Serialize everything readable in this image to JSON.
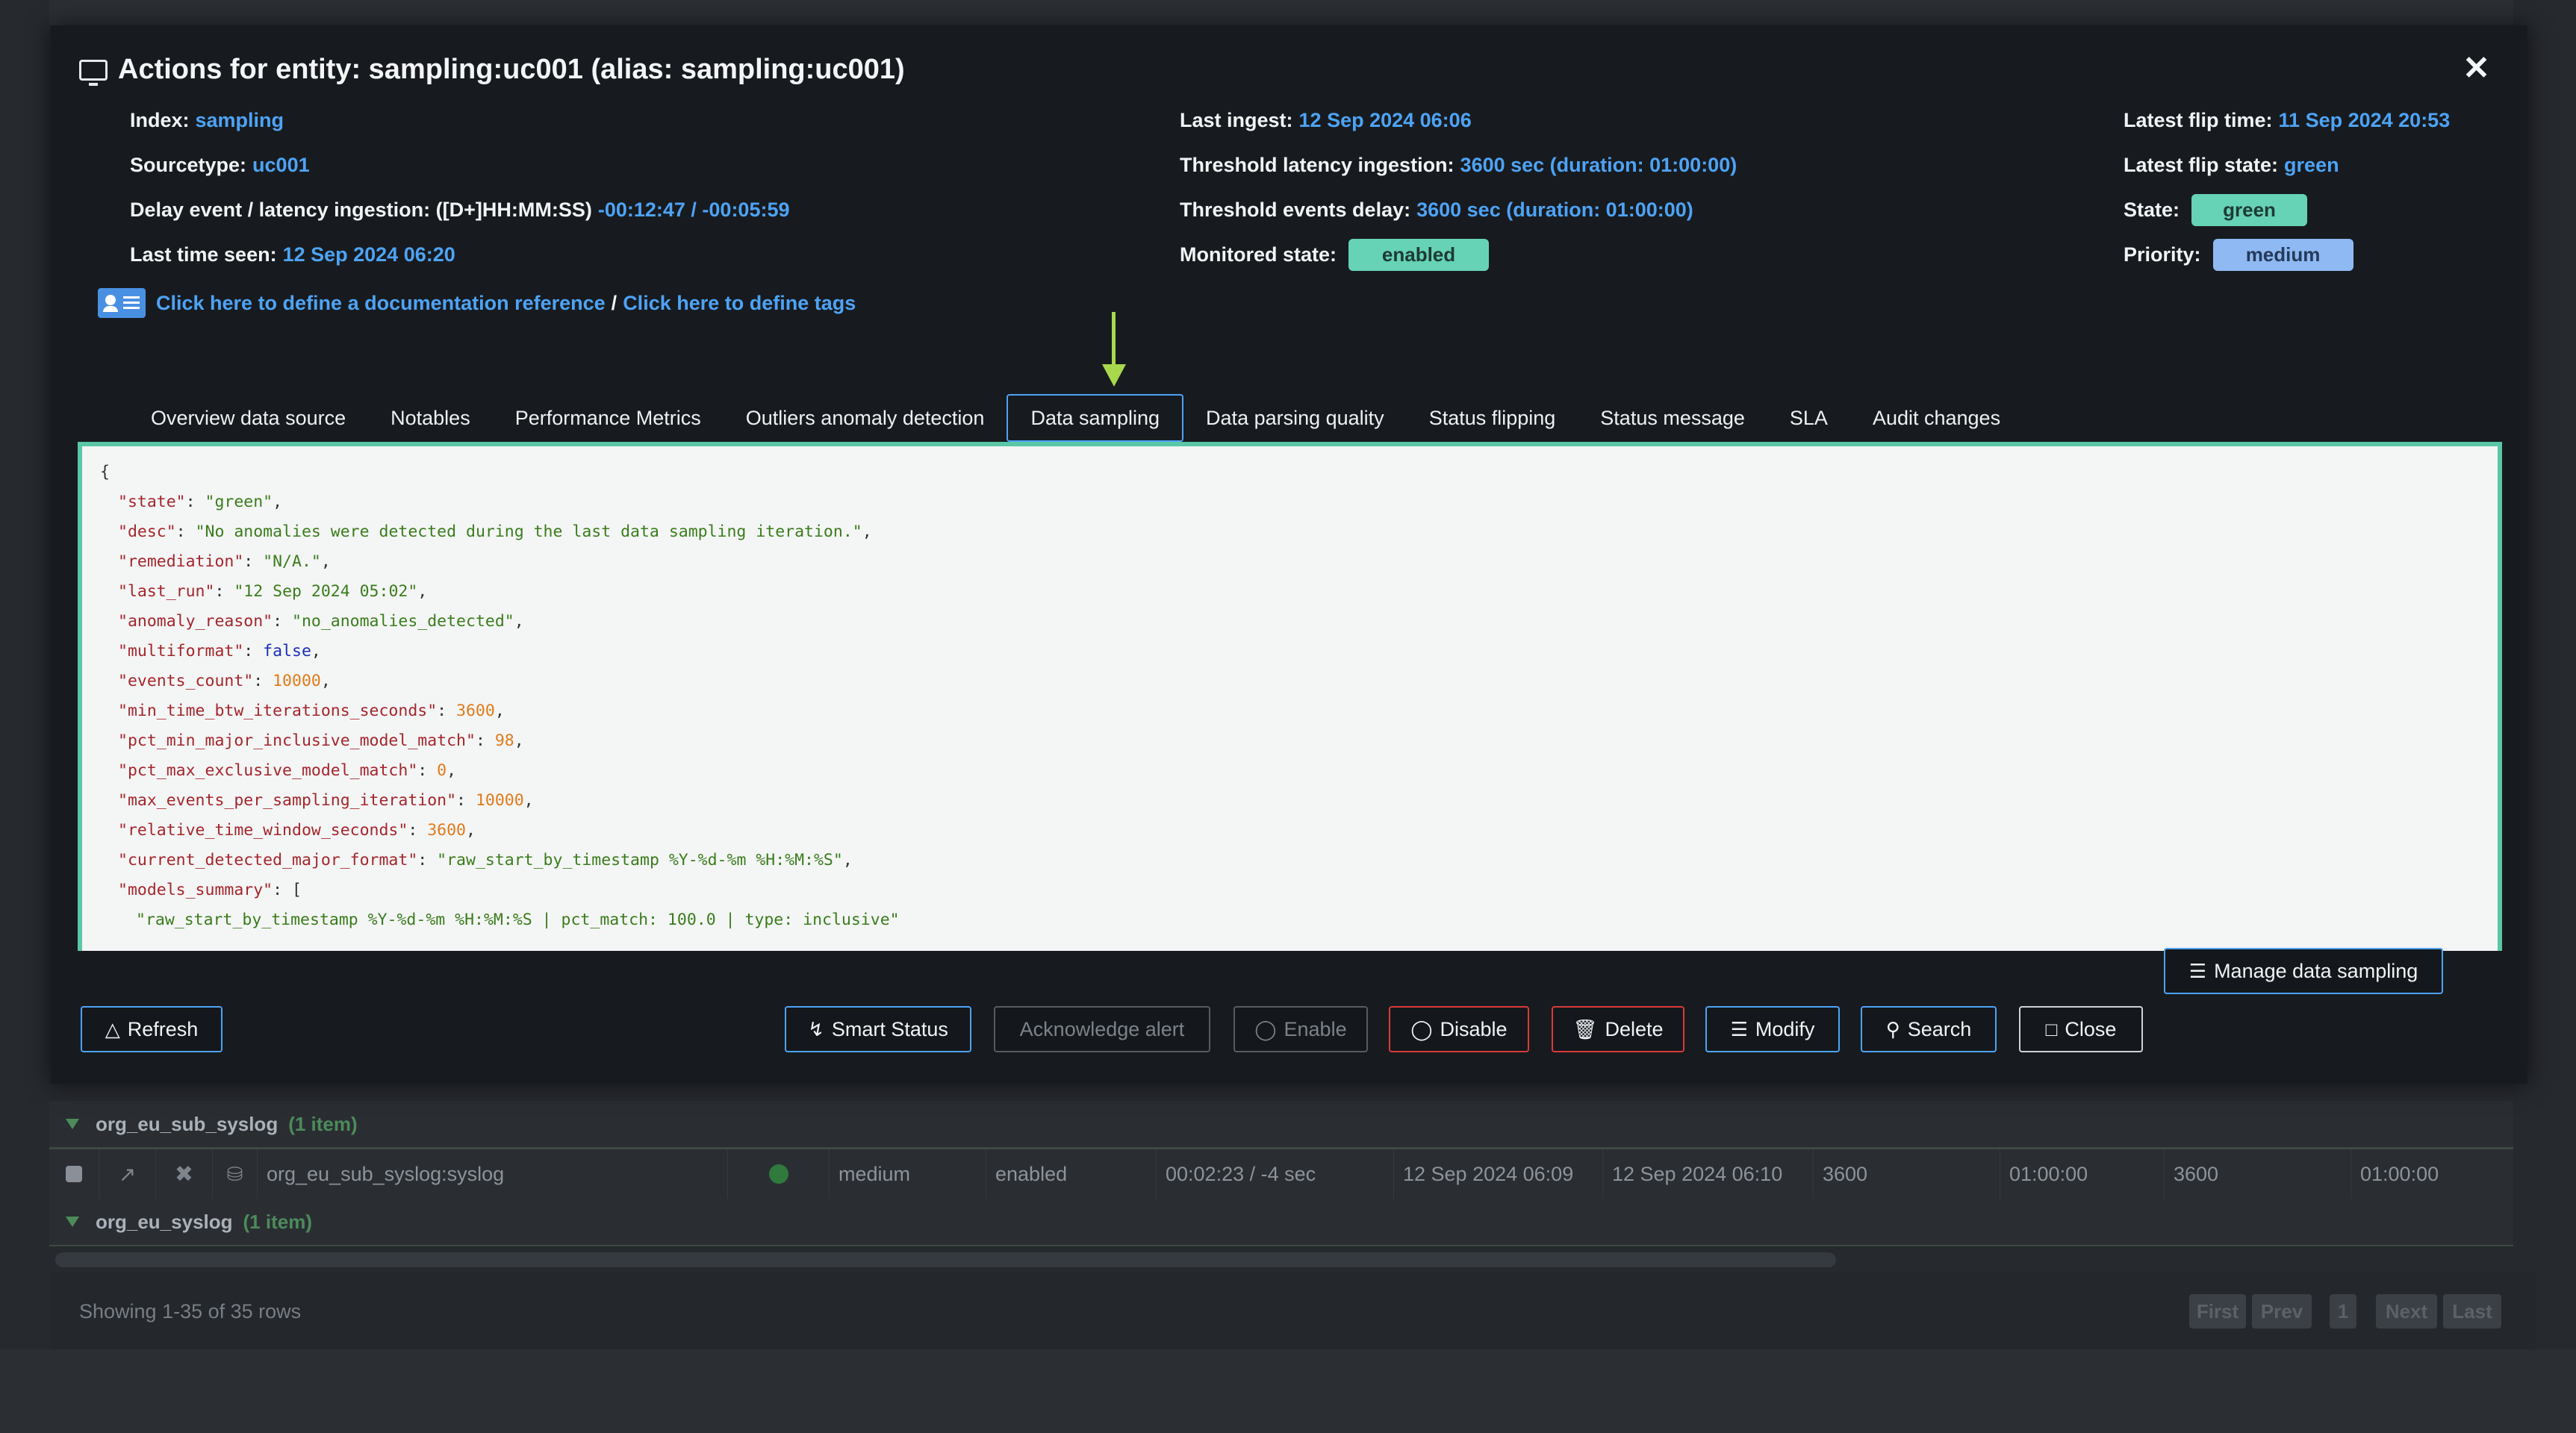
{
  "modal": {
    "title": "Actions for entity: sampling:uc001 (alias: sampling:uc001)",
    "icon": "monitor-icon",
    "info": {
      "index_label": "Index:",
      "index_value": "sampling",
      "sourcetype_label": "Sourcetype:",
      "sourcetype_value": "uc001",
      "delay_label": "Delay event / latency ingestion: ([D+]HH:MM:SS)",
      "delay_value": "-00:12:47 / -00:05:59",
      "last_seen_label": "Last time seen:",
      "last_seen_value": "12 Sep 2024 06:20",
      "last_ingest_label": "Last ingest:",
      "last_ingest_value": "12 Sep 2024 06:06",
      "threshold_latency_label": "Threshold latency ingestion:",
      "threshold_latency_value": "3600 sec (duration: 01:00:00)",
      "threshold_events_label": "Threshold events delay:",
      "threshold_events_value": "3600 sec (duration: 01:00:00)",
      "monitored_label": "Monitored state:",
      "monitored_value": "enabled",
      "flip_time_label": "Latest flip time:",
      "flip_time_value": "11 Sep 2024 20:53",
      "flip_state_label": "Latest flip state:",
      "flip_state_value": "green",
      "state_label": "State:",
      "state_value": "green",
      "priority_label": "Priority:",
      "priority_value": "medium"
    },
    "doc_link": "Click here to define a documentation reference",
    "doc_sep": "/",
    "tags_link": "Click here to define tags",
    "tabs": [
      {
        "label": "Overview data source"
      },
      {
        "label": "Notables"
      },
      {
        "label": "Performance Metrics"
      },
      {
        "label": "Outliers anomaly detection"
      },
      {
        "label": "Data sampling"
      },
      {
        "label": "Data parsing quality"
      },
      {
        "label": "Status flipping"
      },
      {
        "label": "Status message"
      },
      {
        "label": "SLA"
      },
      {
        "label": "Audit changes"
      }
    ],
    "active_tab": "Data sampling",
    "json": {
      "open_brace": "{",
      "lines": [
        {
          "key": "\"state\"",
          "value": "\"green\"",
          "type": "s",
          "tail": ","
        },
        {
          "key": "\"desc\"",
          "value": "\"No anomalies were detected during the last data sampling iteration.\"",
          "type": "s",
          "tail": ","
        },
        {
          "key": "\"remediation\"",
          "value": "\"N/A.\"",
          "type": "s",
          "tail": ","
        },
        {
          "key": "\"last_run\"",
          "value": "\"12 Sep 2024 05:02\"",
          "type": "s",
          "tail": ","
        },
        {
          "key": "\"anomaly_reason\"",
          "value": "\"no_anomalies_detected\"",
          "type": "s",
          "tail": ","
        },
        {
          "key": "\"multiformat\"",
          "value": "false",
          "type": "b",
          "tail": ","
        },
        {
          "key": "\"events_count\"",
          "value": "10000",
          "type": "n",
          "tail": ","
        },
        {
          "key": "\"min_time_btw_iterations_seconds\"",
          "value": "3600",
          "type": "n",
          "tail": ","
        },
        {
          "key": "\"pct_min_major_inclusive_model_match\"",
          "value": "98",
          "type": "n",
          "tail": ","
        },
        {
          "key": "\"pct_max_exclusive_model_match\"",
          "value": "0",
          "type": "n",
          "tail": ","
        },
        {
          "key": "\"max_events_per_sampling_iteration\"",
          "value": "10000",
          "type": "n",
          "tail": ","
        },
        {
          "key": "\"relative_time_window_seconds\"",
          "value": "3600",
          "type": "n",
          "tail": ","
        },
        {
          "key": "\"current_detected_major_format\"",
          "value": "\"raw_start_by_timestamp %Y-%d-%m %H:%M:%S\"",
          "type": "s",
          "tail": ","
        },
        {
          "key": "\"models_summary\"",
          "value": "",
          "type": "p",
          "tail": "["
        }
      ],
      "partial_line": "\"raw_start_by_timestamp %Y-%d-%m %H:%M:%S | pct_match: 100.0 | type: inclusive\""
    },
    "buttons": {
      "manage": "Manage data sampling",
      "refresh": "Refresh",
      "smart_status": "Smart Status",
      "ack": "Acknowledge alert",
      "enable": "Enable",
      "disable": "Disable",
      "delete": "Delete",
      "modify": "Modify",
      "search": "Search",
      "close": "Close"
    }
  },
  "background": {
    "groups": [
      {
        "name": "org_eu_sub_syslog",
        "count": "(1 item)"
      },
      {
        "name": "org_eu_syslog",
        "count": "(1 item)"
      }
    ],
    "row": {
      "name": "org_eu_sub_syslog:syslog",
      "priority": "medium",
      "monitored": "enabled",
      "latency": "00:02:23 / -4 sec",
      "last_ingest": "12 Sep 2024 06:09",
      "last_seen": "12 Sep 2024 06:10",
      "t1": "3600",
      "d1": "01:00:00",
      "t2": "3600",
      "d2": "01:00:00"
    },
    "footer": {
      "rows": "Showing 1-35 of 35 rows",
      "first": "First",
      "prev": "Prev",
      "page": "1",
      "next": "Next",
      "last": "Last"
    }
  }
}
